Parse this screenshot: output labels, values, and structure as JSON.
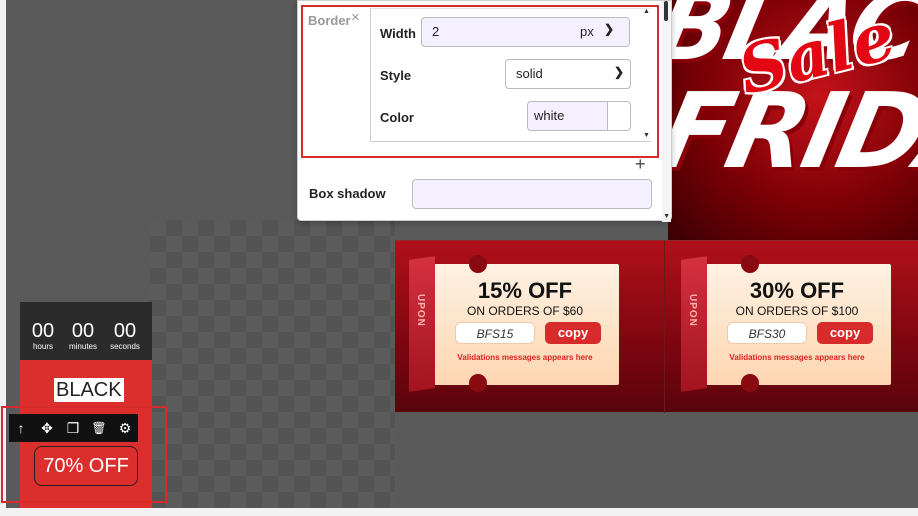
{
  "panel": {
    "border": {
      "label": "Border",
      "close_icon": "×",
      "width_label": "Width",
      "width_value": "2",
      "width_unit": "px",
      "style_label": "Style",
      "style_value": "solid",
      "color_label": "Color",
      "color_value": "white"
    },
    "add_icon": "+",
    "box_shadow_label": "Box shadow",
    "box_shadow_value": ""
  },
  "hero": {
    "word_1": "BLAC",
    "word_2": "FRIDA",
    "sale": "Sale"
  },
  "coupons": [
    {
      "title": "15% OFF",
      "subtitle": "ON ORDERS OF $60",
      "code": "BFS15",
      "copy_label": "copy",
      "validation": "Validations messages appears here",
      "stub_text": "UPON"
    },
    {
      "title": "30% OFF",
      "subtitle": "ON ORDERS OF $100",
      "code": "BFS30",
      "copy_label": "copy",
      "validation": "Validations messages appears here",
      "stub_text": "UPON"
    }
  ],
  "mini_banner": {
    "timer": [
      {
        "value": "00",
        "unit": "hours"
      },
      {
        "value": "00",
        "unit": "minutes"
      },
      {
        "value": "00",
        "unit": "seconds"
      }
    ],
    "black_label": "BLACK",
    "off_button": "70% OFF"
  },
  "toolbar": {
    "icons": [
      "arrow-up-icon",
      "move-icon",
      "duplicate-icon",
      "trash-icon",
      "gear-icon"
    ],
    "glyphs": [
      "↑",
      "✥",
      "❐",
      "🗑",
      "⚙"
    ]
  },
  "colors": {
    "accent_red": "#d62b2b",
    "banner_red": "#dd2e2e",
    "input_bg": "#f4f0ff"
  }
}
